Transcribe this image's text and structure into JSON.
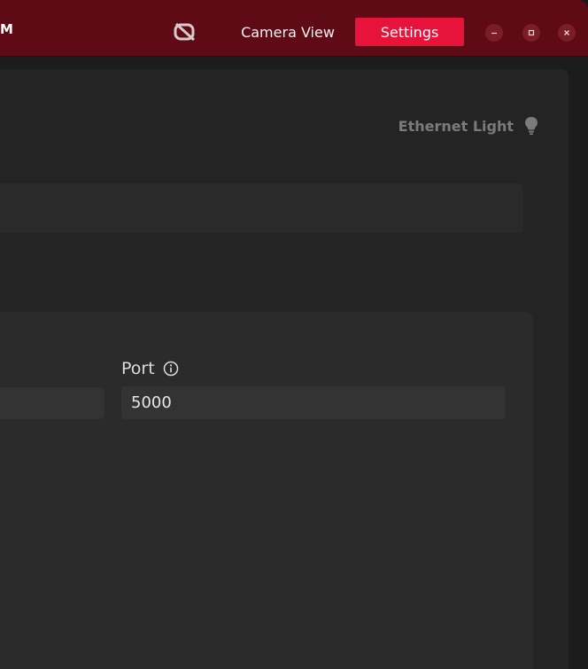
{
  "titlebar": {
    "title_fragment": "M",
    "logo_icon": "camera-crossed-logo-icon",
    "nav": {
      "camera_view_label": "Camera View",
      "settings_label": "Settings"
    },
    "window_controls": {
      "minimize_icon": "minimize-icon",
      "maximize_icon": "maximize-icon",
      "close_icon": "close-icon"
    },
    "colors": {
      "bar": "#5e0b16",
      "active_tab": "#e8133a"
    }
  },
  "status": {
    "ethernet_light_label": "Ethernet Light",
    "ethernet_light_icon": "lightbulb-icon"
  },
  "form": {
    "port_label": "Port",
    "port_info_icon": "info-icon",
    "port_value": "5000"
  }
}
